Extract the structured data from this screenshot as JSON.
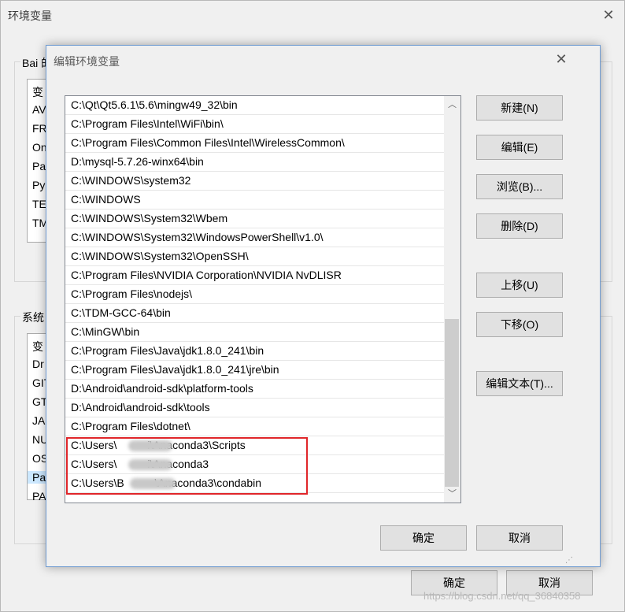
{
  "outer_window": {
    "title": "环境变量",
    "user_vars_label": "Bai 的",
    "user_vars_rows": [
      "变",
      "AV",
      "FR",
      "On",
      "Pa",
      "Py",
      "TE",
      "TM"
    ],
    "system_vars_label": "系统",
    "system_vars_rows": [
      "变",
      "Dr",
      "GIT",
      "GT",
      "JA",
      "NU",
      "OS",
      "Pa",
      "PA"
    ],
    "ok_label": "确定",
    "cancel_label": "取消"
  },
  "dialog": {
    "title": "编辑环境变量",
    "paths": [
      "C:\\Qt\\Qt5.6.1\\5.6\\mingw49_32\\bin",
      "C:\\Program Files\\Intel\\WiFi\\bin\\",
      "C:\\Program Files\\Common Files\\Intel\\WirelessCommon\\",
      "D:\\mysql-5.7.26-winx64\\bin",
      "C:\\WINDOWS\\system32",
      "C:\\WINDOWS",
      "C:\\WINDOWS\\System32\\Wbem",
      "C:\\WINDOWS\\System32\\WindowsPowerShell\\v1.0\\",
      "C:\\WINDOWS\\System32\\OpenSSH\\",
      "C:\\Program Files\\NVIDIA Corporation\\NVIDIA NvDLISR",
      "C:\\Program Files\\nodejs\\",
      "C:\\TDM-GCC-64\\bin",
      "C:\\MinGW\\bin",
      "C:\\Program Files\\Java\\jdk1.8.0_241\\bin",
      "C:\\Program Files\\Java\\jdk1.8.0_241\\jre\\bin",
      "D:\\Android\\android-sdk\\platform-tools",
      "D:\\Android\\android-sdk\\tools",
      "C:\\Program Files\\dotnet\\",
      "C:\\Users\\          i\\Anaconda3\\Scripts",
      "C:\\Users\\          i\\Anaconda3",
      "C:\\Users\\B          \\Anaconda3\\condabin"
    ],
    "buttons": {
      "new": "新建(N)",
      "edit": "编辑(E)",
      "browse": "浏览(B)...",
      "delete": "删除(D)",
      "move_up": "上移(U)",
      "move_down": "下移(O)",
      "edit_text": "编辑文本(T)..."
    },
    "ok_label": "确定",
    "cancel_label": "取消"
  },
  "watermark": "https://blog.csdn.net/qq_36840358",
  "colors": {
    "highlight_border": "#e0262a",
    "dialog_border": "#6f9bd2"
  }
}
